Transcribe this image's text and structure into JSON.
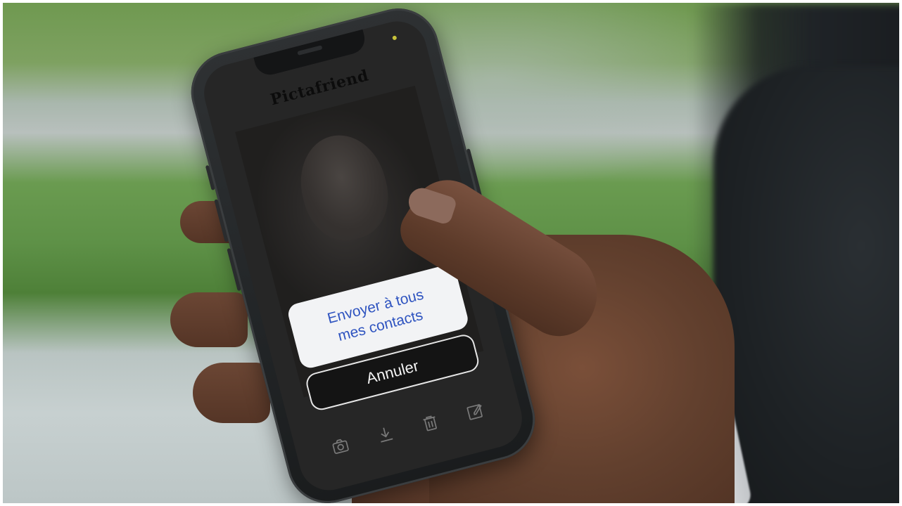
{
  "app": {
    "title": "Pictafriend"
  },
  "dialog": {
    "send_all_label": "Envoyer à tous\nmes contacts",
    "cancel_label": "Annuler"
  },
  "toolbar": {
    "items": [
      {
        "icon": "camera-icon"
      },
      {
        "icon": "download-icon"
      },
      {
        "icon": "trash-icon"
      },
      {
        "icon": "edit-icon"
      }
    ]
  },
  "colors": {
    "action_text": "#2f54c0",
    "sheet_background": "#f2f3f5",
    "cancel_background": "#141414",
    "screen_background": "#262626"
  }
}
